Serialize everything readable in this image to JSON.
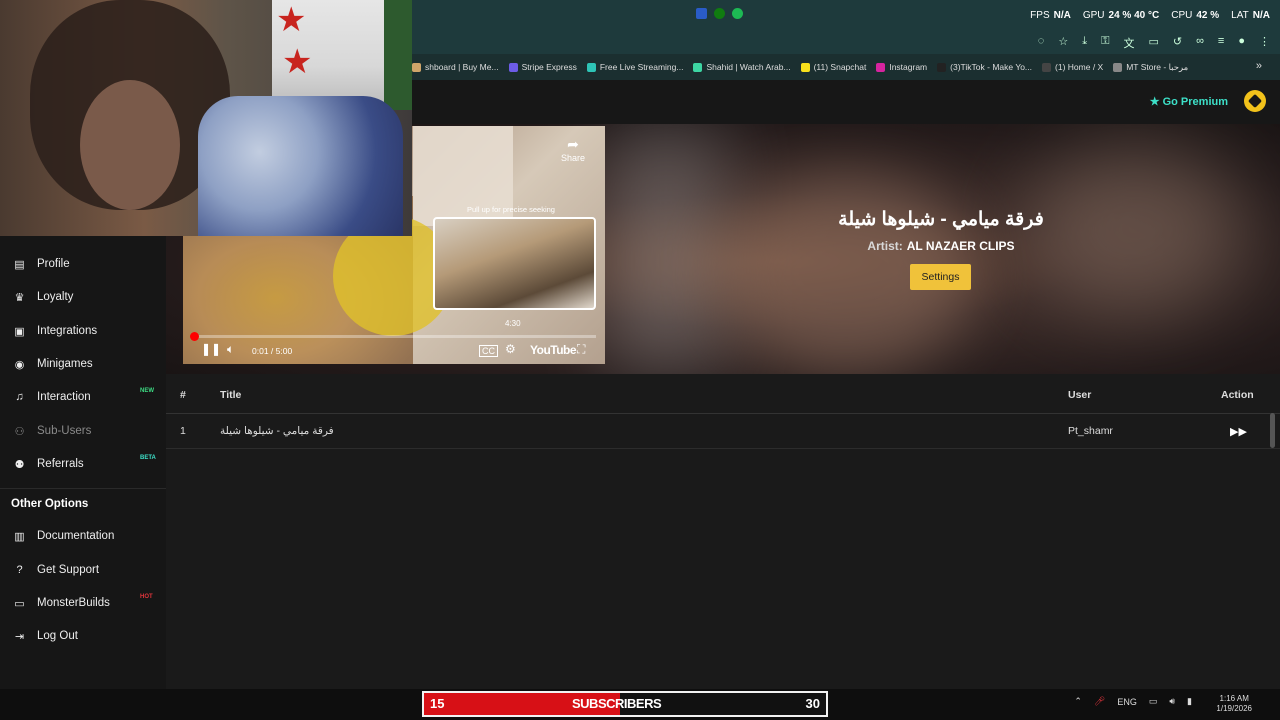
{
  "hud": {
    "fps_label": "FPS",
    "fps_value": "N/A",
    "gpu_label": "GPU",
    "gpu_usage": "24 %",
    "gpu_temp": "40 °C",
    "cpu_label": "CPU",
    "cpu_usage": "42 %",
    "lat_label": "LAT",
    "lat_value": "N/A"
  },
  "bookmarks": [
    {
      "label": "shboard | Buy Me...",
      "color": "#cfa56a"
    },
    {
      "label": "Stripe Express",
      "color": "#6c5ce7"
    },
    {
      "label": "Free Live Streaming...",
      "color": "#2ec4b6"
    },
    {
      "label": "Shahid | Watch Arab...",
      "color": "#3dd6a3"
    },
    {
      "label": "(11) Snapchat",
      "color": "#f7e01c"
    },
    {
      "label": "Instagram",
      "color": "#d6249f"
    },
    {
      "label": "(3)TikTok - Make Yo...",
      "color": "#222222"
    },
    {
      "label": "(1) Home / X",
      "color": "#444444"
    },
    {
      "label": "MT Store - مرحبا",
      "color": "#888888"
    }
  ],
  "header": {
    "premium_label": "Go Premium"
  },
  "sidebar": {
    "items": [
      {
        "label": "Profile",
        "icon": "id-card-icon"
      },
      {
        "label": "Loyalty",
        "icon": "trophy-icon"
      },
      {
        "label": "Integrations",
        "icon": "integrations-icon"
      },
      {
        "label": "Minigames",
        "icon": "gamepad-icon"
      },
      {
        "label": "Interaction",
        "icon": "music-icon",
        "tag": "NEW"
      },
      {
        "label": "Sub-Users",
        "icon": "users-icon"
      },
      {
        "label": "Referrals",
        "icon": "user-plus-icon",
        "tag": "BETA"
      }
    ],
    "other_title": "Other Options",
    "other_items": [
      {
        "label": "Documentation",
        "icon": "book-icon"
      },
      {
        "label": "Get Support",
        "icon": "question-icon"
      },
      {
        "label": "MonsterBuilds",
        "icon": "laptop-icon",
        "tag": "HOT"
      },
      {
        "label": "Log Out",
        "icon": "logout-icon"
      }
    ]
  },
  "player": {
    "share_label": "Share",
    "seek_hint": "Pull up for precise seeking",
    "preview_time": "4:30",
    "time_display": "0:01 / 5:00",
    "progress": 0.003,
    "brand": "YouTube"
  },
  "now_playing": {
    "title": "فرقة ميامي - شيلوها شيلة",
    "artist_label": "Artist:",
    "artist": "AL NAZAER CLIPS",
    "settings_label": "Settings"
  },
  "queue": {
    "columns": [
      "#",
      "Title",
      "User",
      "Action"
    ],
    "rows": [
      {
        "num": "1",
        "title": "فرقة ميامي - شيلوها شيلة",
        "user": "Pt_shamr"
      }
    ]
  },
  "taskbar": {
    "sub_left": "15",
    "sub_label": "SUBSCRIBERS",
    "sub_right": "30",
    "lang": "ENG",
    "time": "1:16 AM",
    "date": "1/19/2026"
  }
}
